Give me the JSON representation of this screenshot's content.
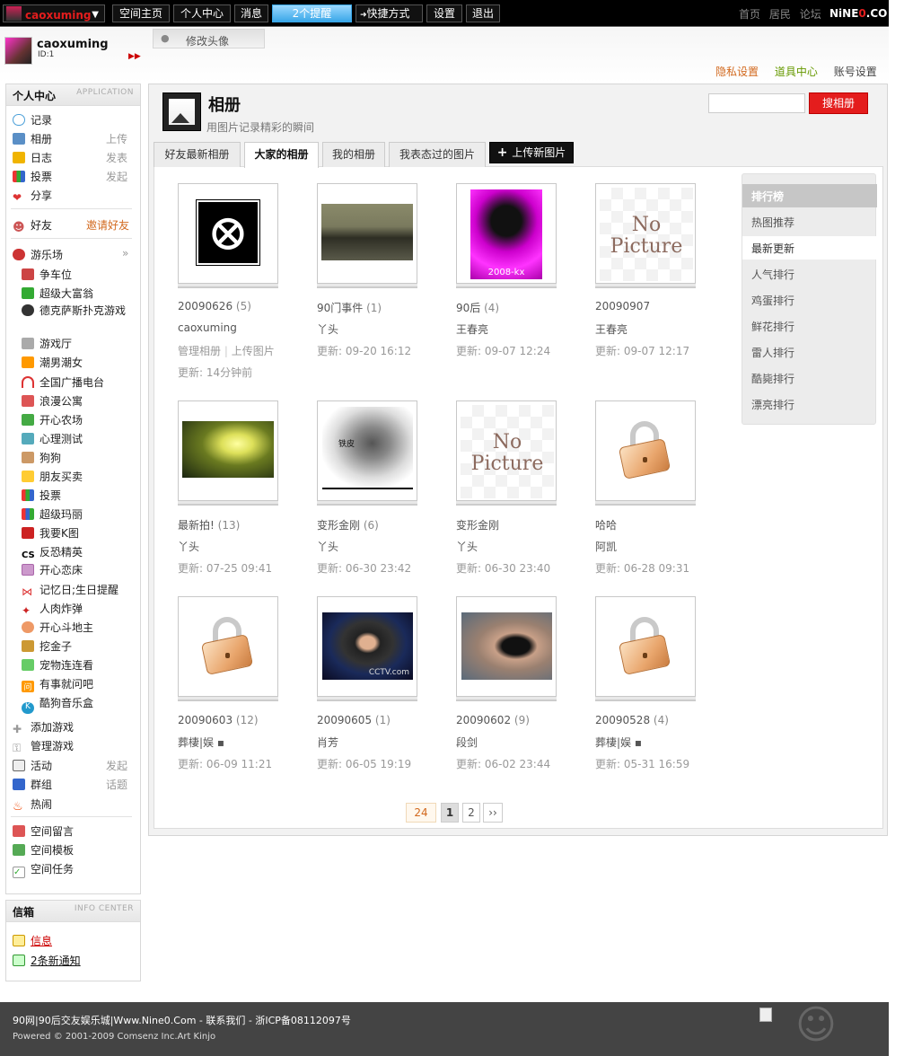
{
  "topbar": {
    "username": "caoxuming",
    "items": [
      "空间主页",
      "个人中心",
      "消息",
      "2个提醒",
      "快捷方式",
      "设置",
      "退出"
    ],
    "right_links": [
      "首页",
      "居民",
      "论坛"
    ],
    "logo_prefix": "NiNE",
    "logo_accent": "0",
    "logo_suffix": ".CO"
  },
  "header": {
    "username": "caoxuming",
    "id_label": "ID:1",
    "avatar_tab": "修改头像",
    "links": [
      "隐私设置",
      "道具中心",
      "账号设置"
    ]
  },
  "sidebar": {
    "title": "个人中心",
    "title_en": "APPLICATION",
    "items": [
      {
        "label": "记录",
        "aux": ""
      },
      {
        "label": "相册",
        "aux": "上传"
      },
      {
        "label": "日志",
        "aux": "发表"
      },
      {
        "label": "投票",
        "aux": "发起"
      },
      {
        "label": "分享",
        "aux": ""
      }
    ],
    "friends_label": "好友",
    "friends_aux": "邀请好友",
    "games_label": "游乐场",
    "games": [
      "争车位",
      "超级大富翁",
      "德克萨斯扑克游戏",
      "游戏厅",
      "潮男潮女",
      "全国广播电台",
      "浪漫公寓",
      "开心农场",
      "心理测试",
      "狗狗",
      "朋友买卖",
      "投票",
      "超级玛丽",
      "我要K图",
      "反恐精英",
      "开心恋床",
      "记忆日;生日提醒",
      "人肉炸弹",
      "开心斗地主",
      "挖金子",
      "宠物连连看",
      "有事就问吧",
      "酷狗音乐盒"
    ],
    "manage": [
      "添加游戏",
      "管理游戏"
    ],
    "extra": [
      {
        "label": "活动",
        "aux": "发起"
      },
      {
        "label": "群组",
        "aux": "话题"
      },
      {
        "label": "热闹",
        "aux": ""
      }
    ],
    "space": [
      "空间留言",
      "空间模板",
      "空间任务"
    ]
  },
  "inbox": {
    "title": "信箱",
    "title_en": "INFO CENTER",
    "items": [
      "信息",
      "2条新通知"
    ]
  },
  "album": {
    "title": "相册",
    "subtitle": "用图片记录精彩的瞬间",
    "search_button": "搜相册",
    "tabs": [
      "好友最新相册",
      "大家的相册",
      "我的相册",
      "我表态过的图片"
    ],
    "upload_button": "上传新图片",
    "cards": [
      {
        "name": "20090626",
        "count": "(5)",
        "owner": "caoxuming",
        "actions": [
          "管理相册",
          "上传图片"
        ],
        "updated": "更新: 14分钟前",
        "thumb": "logo"
      },
      {
        "name": "90门事件",
        "count": "(1)",
        "owner": "丫头",
        "updated": "更新: 09-20 16:12",
        "thumb": "photo-classroom"
      },
      {
        "name": "90后",
        "count": "(4)",
        "owner": "王春亮",
        "updated": "更新: 09-07 12:24",
        "thumb": "photo-pink",
        "thumb_text": "2008-kx"
      },
      {
        "name": "20090907",
        "count": "",
        "owner": "王春亮",
        "updated": "更新: 09-07 12:17",
        "thumb": "no-picture"
      },
      {
        "name": "最新拍!",
        "count": "(13)",
        "owner": "丫头",
        "updated": "更新: 07-25 09:41",
        "thumb": "photo-field"
      },
      {
        "name": "变形金刚",
        "count": "(6)",
        "owner": "丫头",
        "updated": "更新: 06-30 23:42",
        "thumb": "photo-robot",
        "thumb_text": "铁皮"
      },
      {
        "name": "变形金刚",
        "count": "",
        "owner": "丫头",
        "updated": "更新: 06-30 23:40",
        "thumb": "no-picture"
      },
      {
        "name": "哈哈",
        "count": "",
        "owner": "阿凯",
        "updated": "更新: 06-28 09:31",
        "thumb": "lock"
      },
      {
        "name": "20090603",
        "count": "(12)",
        "owner": "葬棲|娱 ▪",
        "updated": "更新: 06-09 11:21",
        "thumb": "lock"
      },
      {
        "name": "20090605",
        "count": "(1)",
        "owner": "肖芳",
        "updated": "更新: 06-05 19:19",
        "thumb": "photo-cctv",
        "thumb_text": "CCTV.com"
      },
      {
        "name": "20090602",
        "count": "(9)",
        "owner": "段剑",
        "updated": "更新: 06-02 23:44",
        "thumb": "photo-face"
      },
      {
        "name": "20090528",
        "count": "(4)",
        "owner": "葬棲|娱 ▪",
        "updated": "更新: 05-31 16:59",
        "thumb": "lock"
      }
    ],
    "no_picture_line1": "No",
    "no_picture_line2": "Picture"
  },
  "ranking": {
    "title": "排行榜",
    "items": [
      "热图推荐",
      "最新更新",
      "人气排行",
      "鸡蛋排行",
      "鲜花排行",
      "雷人排行",
      "酷毙排行",
      "漂亮排行"
    ],
    "active_index": 1
  },
  "pager": {
    "total": "24",
    "pages": [
      "1",
      "2"
    ],
    "next": "››",
    "current": "1"
  },
  "footer": {
    "line1": "90网|90后交友娱乐城|Www.Nine0.Com - 联系我们   - 浙ICP备08112097号",
    "line2": "Powered © 2001-2009 Comsenz Inc.Art Kinjo"
  },
  "colors": {
    "accent_red": "#e41d1d",
    "link_orange": "#d2691e",
    "link_green": "#669900",
    "alert_blue": "#3aa7e8"
  }
}
